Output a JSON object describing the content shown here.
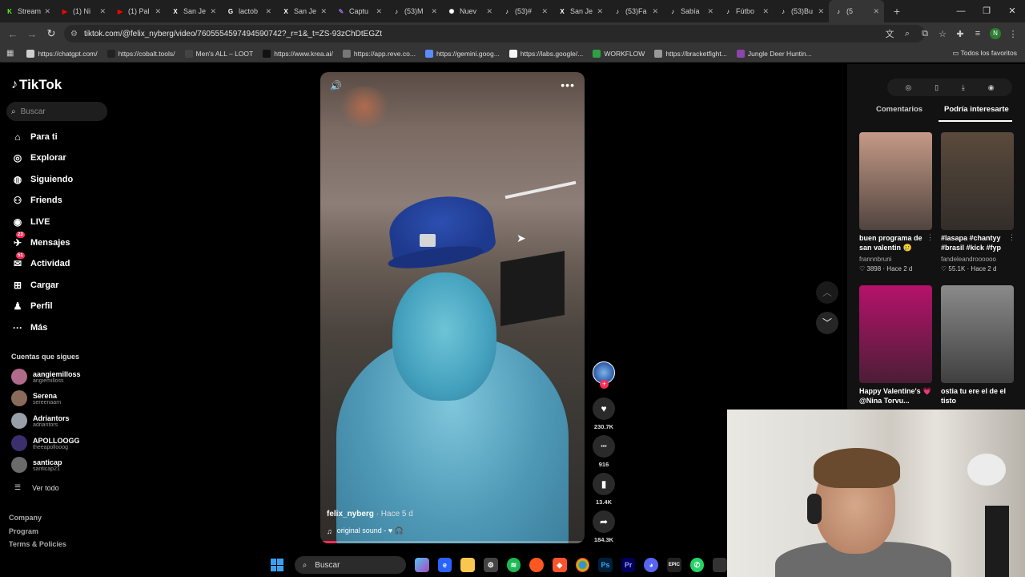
{
  "browser": {
    "tabs": [
      {
        "label": "Stream",
        "icon": "kick-icon",
        "color": "#53fc18"
      },
      {
        "label": "(1) Ni",
        "icon": "youtube-icon",
        "color": "#ff0000"
      },
      {
        "label": "(1) Pal",
        "icon": "youtube-icon",
        "color": "#ff0000"
      },
      {
        "label": "San Je",
        "icon": "x-icon",
        "color": "#ffffff"
      },
      {
        "label": "lactob",
        "icon": "google-icon",
        "color": "#ffffff"
      },
      {
        "label": "San Je",
        "icon": "x-icon",
        "color": "#ffffff"
      },
      {
        "label": "Captu",
        "icon": "feather-icon",
        "color": "#9b6bd6"
      },
      {
        "label": "(53)M",
        "icon": "tiktok-icon",
        "color": "#ffffff"
      },
      {
        "label": "Nuev",
        "icon": "chatgpt-icon",
        "color": "#ffffff"
      },
      {
        "label": "(53)#",
        "icon": "tiktok-icon",
        "color": "#ffffff"
      },
      {
        "label": "San Je",
        "icon": "x-icon",
        "color": "#ffffff"
      },
      {
        "label": "(53)Fa",
        "icon": "tiktok-icon",
        "color": "#ffffff"
      },
      {
        "label": "Sabía",
        "icon": "tiktok-icon",
        "color": "#ffffff"
      },
      {
        "label": "Fútbo",
        "icon": "tiktok-icon",
        "color": "#ffffff"
      },
      {
        "label": "(53)Bu",
        "icon": "tiktok-icon",
        "color": "#ffffff"
      },
      {
        "label": "(5",
        "icon": "tiktok-icon",
        "color": "#ffffff",
        "active": true
      }
    ],
    "url": "tiktok.com/@felix_nyberg/video/7605554597494590742?_r=1&_t=ZS-93zChDtEGZt",
    "profile_initial": "N",
    "bookmarks": [
      {
        "label": "https://chatgpt.com/",
        "color": "#cfcfcf"
      },
      {
        "label": "https://cobalt.tools/",
        "color": "#222222"
      },
      {
        "label": "Men's ALL – LOOT",
        "color": "#444444"
      },
      {
        "label": "https://www.krea.ai/",
        "color": "#111111"
      },
      {
        "label": "https://app.reve.co...",
        "color": "#777777"
      },
      {
        "label": "https://gemini.goog...",
        "color": "#5b8cff"
      },
      {
        "label": "https://labs.google/...",
        "color": "#f5f5f5"
      },
      {
        "label": "WORKFLOW",
        "color": "#2ea043"
      },
      {
        "label": "https://bracketfight...",
        "color": "#999999"
      },
      {
        "label": "Jungle Deer Huntin...",
        "color": "#8e44ad"
      }
    ],
    "all_favorites": "Todos los favoritos"
  },
  "sidebar": {
    "logo": "TikTok",
    "search_placeholder": "Buscar",
    "nav": [
      {
        "label": "Para ti",
        "icon": "home-icon"
      },
      {
        "label": "Explorar",
        "icon": "compass-icon"
      },
      {
        "label": "Siguiendo",
        "icon": "following-icon"
      },
      {
        "label": "Friends",
        "icon": "friends-icon"
      },
      {
        "label": "LIVE",
        "icon": "live-icon"
      },
      {
        "label": "Mensajes",
        "icon": "messages-icon",
        "badge": "23"
      },
      {
        "label": "Actividad",
        "icon": "activity-icon",
        "badge": "51"
      },
      {
        "label": "Cargar",
        "icon": "upload-icon"
      },
      {
        "label": "Perfil",
        "icon": "profile-icon"
      },
      {
        "label": "Más",
        "icon": "more-icon"
      }
    ],
    "following_title": "Cuentas que sigues",
    "accounts": [
      {
        "name": "aangiemilloss",
        "handle": "angiemilloss",
        "color": "#b06a8a"
      },
      {
        "name": "Serena",
        "handle": "sereenaam",
        "color": "#8a6a5a"
      },
      {
        "name": "Adriantors",
        "handle": "adriantors",
        "color": "#9aa0aa"
      },
      {
        "name": "APOLLOOGG",
        "handle": "theeapollooog",
        "color": "#3c2f6e"
      },
      {
        "name": "santicap",
        "handle": "santicap21",
        "color": "#6a6a6a"
      }
    ],
    "see_all": "Ver todo",
    "footer": [
      "Company",
      "Program",
      "Terms & Policies"
    ]
  },
  "video": {
    "author": "felix_nyberg",
    "ago": "· Hace 5 d",
    "sound": "original sound - ♥ 🎧",
    "progress": 0.06
  },
  "actions": [
    {
      "icon": "heart-icon",
      "glyph": "♥",
      "count": "230.7K"
    },
    {
      "icon": "comment-icon",
      "glyph": "•••",
      "count": "916"
    },
    {
      "icon": "bookmark-icon",
      "glyph": "▮",
      "count": "13.4K"
    },
    {
      "icon": "share-icon",
      "glyph": "➦",
      "count": "184.3K"
    }
  ],
  "right_panel": {
    "tab_comments": "Comentarios",
    "tab_interest": "Podría interesarte",
    "items": [
      {
        "caption": "buen programa de san valentin 🥲",
        "user": "frannnbruni",
        "meta": "♡ 3898 · Hace 2 d",
        "color": "#c59a86"
      },
      {
        "caption": "#lasapa #chantyy #brasil #kick #fyp",
        "user": "fandeleandroooooo",
        "meta": "♡ 55.1K · Hace 2 d",
        "color": "#5a4a3c"
      },
      {
        "caption": "Happy Valentine's 💗 @Nina Torvu...",
        "user": "",
        "meta": "",
        "color": "#b5126a"
      },
      {
        "caption": "ostia tu ere el de el tisto",
        "user": "",
        "meta": "",
        "color": "#8a8a8a"
      }
    ]
  },
  "taskbar": {
    "search_placeholder": "Buscar"
  }
}
